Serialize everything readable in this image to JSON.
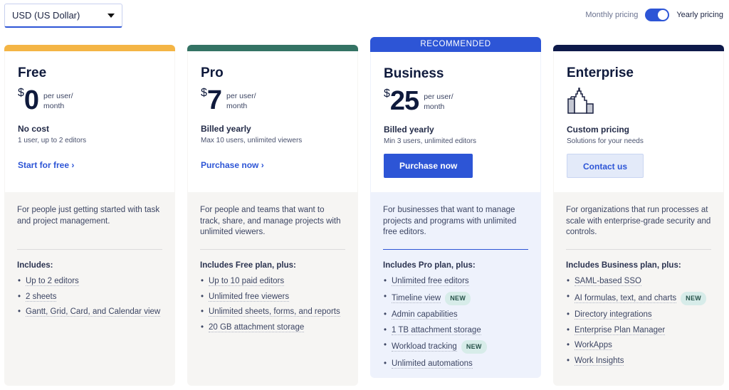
{
  "currency": {
    "selected": "USD (US Dollar)"
  },
  "pricing_toggle": {
    "monthly_label": "Monthly pricing",
    "yearly_label": "Yearly pricing",
    "selected": "yearly"
  },
  "plans": [
    {
      "name": "Free",
      "accent": "#f4b545",
      "currency_symbol": "$",
      "price": "0",
      "per": [
        "per user/",
        "month"
      ],
      "billing": "No cost",
      "billing_sub": "1 user, up to 2 editors",
      "cta": "Start for free ›",
      "description": "For people just getting started with task and project management.",
      "includes_title": "Includes:",
      "features": [
        {
          "text": "Up to 2 editors"
        },
        {
          "text": "2 sheets"
        },
        {
          "text": "Gantt, Grid, Card, and Calendar view"
        }
      ]
    },
    {
      "name": "Pro",
      "accent": "#347364",
      "currency_symbol": "$",
      "price": "7",
      "per": [
        "per user/",
        "month"
      ],
      "billing": "Billed yearly",
      "billing_sub": "Max 10 users, unlimited viewers",
      "cta": "Purchase now ›",
      "description": "For people and teams that want to track, share, and manage projects with unlimited viewers.",
      "includes_title": "Includes Free plan, plus:",
      "features": [
        {
          "text": "Up to 10 paid editors"
        },
        {
          "text": "Unlimited free viewers"
        },
        {
          "text": "Unlimited sheets, forms, and reports"
        },
        {
          "text": "20 GB attachment storage"
        }
      ]
    },
    {
      "name": "Business",
      "accent": "#2d55d6",
      "banner": "RECOMMENDED",
      "currency_symbol": "$",
      "price": "25",
      "per": [
        "per user/",
        "month"
      ],
      "billing": "Billed yearly",
      "billing_sub": "Min 3 users, unlimited editors",
      "cta": "Purchase now",
      "description": "For businesses that want to manage projects and programs with unlimited free editors.",
      "includes_title": "Includes Pro plan, plus:",
      "features": [
        {
          "text": "Unlimited free editors"
        },
        {
          "text": "Timeline view",
          "badge": "NEW"
        },
        {
          "text": "Admin capabilities"
        },
        {
          "text": "1 TB attachment storage"
        },
        {
          "text": "Workload tracking",
          "badge": "NEW"
        },
        {
          "text": "Unlimited automations"
        }
      ]
    },
    {
      "name": "Enterprise",
      "accent": "#0e1a4a",
      "icon": "building-icon",
      "billing": "Custom pricing",
      "billing_sub": "Solutions for your needs",
      "cta": "Contact us",
      "description": "For organizations that run processes at scale with enterprise-grade security and controls.",
      "includes_title": "Includes Business plan, plus:",
      "features": [
        {
          "text": "SAML-based SSO"
        },
        {
          "text": "AI formulas, text, and charts",
          "badge": "NEW"
        },
        {
          "text": "Directory integrations"
        },
        {
          "text": "Enterprise Plan Manager"
        },
        {
          "text": "WorkApps"
        },
        {
          "text": "Work Insights"
        }
      ]
    }
  ]
}
